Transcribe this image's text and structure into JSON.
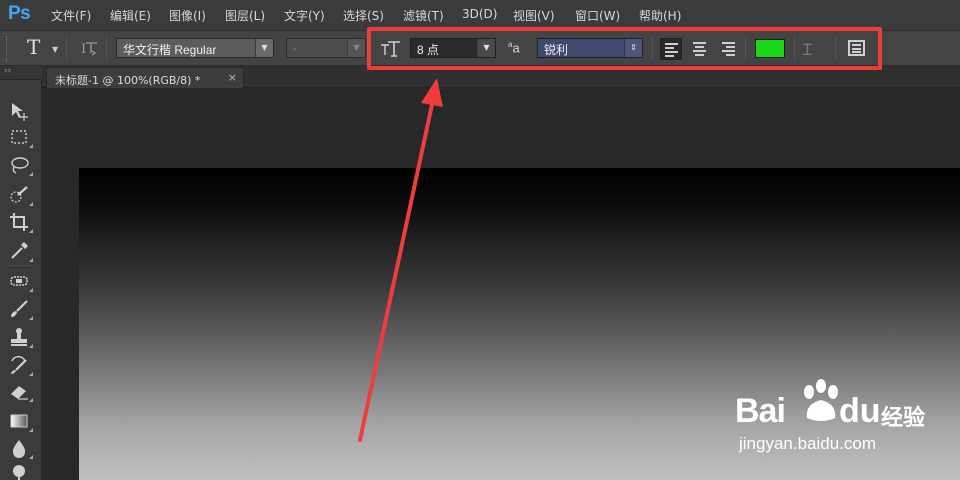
{
  "app": {
    "logo": "Ps"
  },
  "menu": [
    "文件(F)",
    "编辑(E)",
    "图像(I)",
    "图层(L)",
    "文字(Y)",
    "选择(S)",
    "滤镜(T)",
    "3D(D)",
    "视图(V)",
    "窗口(W)",
    "帮助(H)"
  ],
  "options": {
    "text_tool_glyph": "T",
    "font_family": "华文行楷 Regular",
    "font_style": "-",
    "font_size": "8 点",
    "aa_label": "a",
    "aa_sup": "a",
    "antialias": "锐利",
    "text_color": "#19d819"
  },
  "document": {
    "tab_title": "未标题-1 @ 100%(RGB/8) *",
    "close_glyph": "×"
  },
  "toolbox": {
    "collapse_glyph": "››",
    "tools": [
      "move-tool",
      "marquee-tool",
      "lasso-tool",
      "quick-selection-tool",
      "crop-tool",
      "eyedropper-tool",
      "healing-brush-tool",
      "brush-tool",
      "clone-stamp-tool",
      "history-brush-tool",
      "eraser-tool",
      "gradient-tool",
      "blur-tool",
      "dodge-tool"
    ]
  },
  "annotation": {
    "color": "#ee3d3d"
  },
  "watermark": {
    "brand_bai": "Bai",
    "brand_du": "du",
    "brand_cn": "经验",
    "url": "jingyan.baidu.com"
  }
}
